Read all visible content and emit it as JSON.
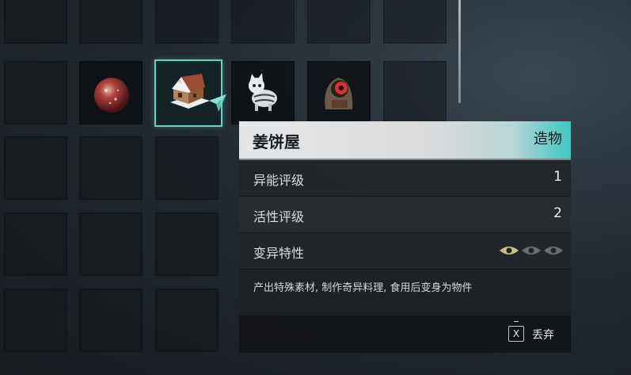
{
  "item": {
    "name": "姜饼屋",
    "category": "造物",
    "stats": [
      {
        "label": "异能评级",
        "value": "1"
      },
      {
        "label": "活性评级",
        "value": "2"
      }
    ],
    "mutation": {
      "label": "变异特性",
      "level": 1,
      "max": 3
    },
    "description": "产出特殊素材, 制作奇异料理, 食用后变身为物件"
  },
  "footer": {
    "key": "X",
    "action": "丢弃"
  },
  "inventory": {
    "items": [
      {
        "name": "red-orb-icon"
      },
      {
        "name": "gingerbread-house-icon",
        "selected": true
      },
      {
        "name": "robot-cat-icon"
      },
      {
        "name": "hooded-creature-icon"
      }
    ]
  },
  "colors": {
    "accent": "#5fd6c5",
    "eye_active": "#c7c08a",
    "eye_inactive": "#6b6f73"
  }
}
